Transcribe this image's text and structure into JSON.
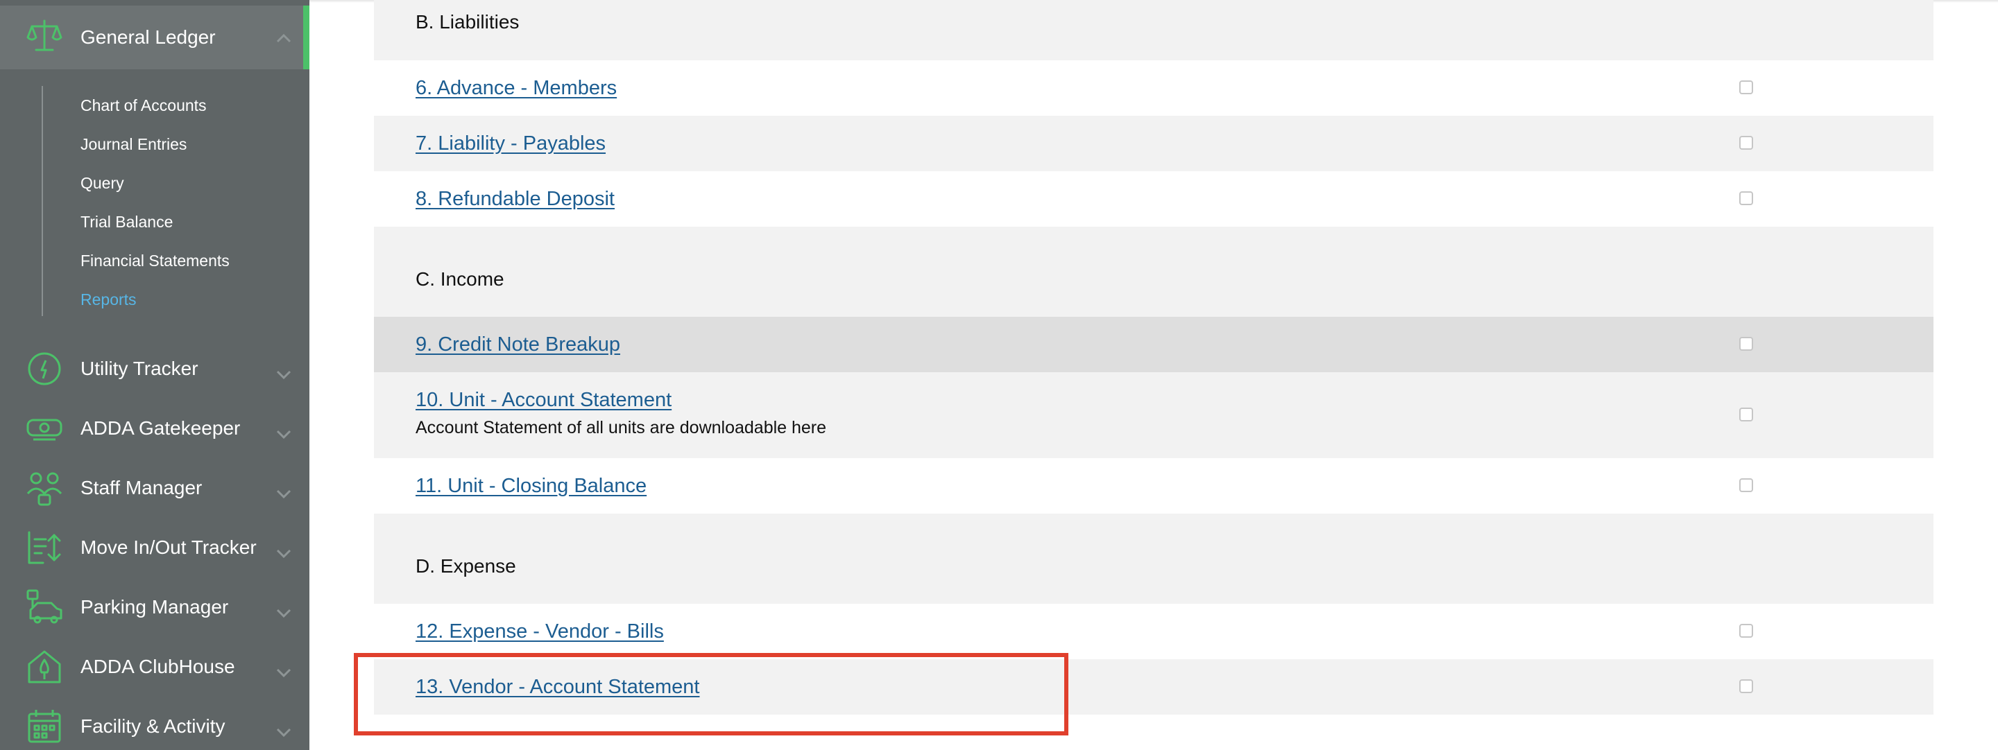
{
  "sidebar": {
    "general_ledger": {
      "label": "General Ledger",
      "sub_items": [
        {
          "label": "Chart of Accounts"
        },
        {
          "label": "Journal Entries"
        },
        {
          "label": "Query"
        },
        {
          "label": "Trial Balance"
        },
        {
          "label": "Financial Statements"
        },
        {
          "label": "Reports"
        }
      ]
    },
    "items": [
      {
        "label": "Utility Tracker",
        "icon": "gauge-icon"
      },
      {
        "label": "ADDA Gatekeeper",
        "icon": "gate-icon"
      },
      {
        "label": "Staff Manager",
        "icon": "staff-icon"
      },
      {
        "label": "Move In/Out Tracker",
        "icon": "move-icon"
      },
      {
        "label": "Parking Manager",
        "icon": "car-icon"
      },
      {
        "label": "ADDA ClubHouse",
        "icon": "clubhouse-icon"
      },
      {
        "label": "Facility & Activity",
        "icon": "calendar-icon"
      }
    ],
    "colors": {
      "accent": "#4cc169",
      "active_link": "#57b6e6",
      "background": "#5f6566"
    }
  },
  "reports": {
    "section_b": "B. Liabilities",
    "section_c": "C. Income",
    "section_d": "D. Expense",
    "rows": [
      {
        "label": "6. Advance - Members"
      },
      {
        "label": "7. Liability - Payables"
      },
      {
        "label": "8. Refundable Deposit"
      },
      {
        "label": "9. Credit Note Breakup"
      },
      {
        "label": "10. Unit - Account Statement",
        "description": "Account Statement of all units are downloadable here"
      },
      {
        "label": "11. Unit - Closing Balance"
      },
      {
        "label": "12. Expense - Vendor - Bills"
      },
      {
        "label": "13. Vendor - Account Statement"
      }
    ],
    "colors": {
      "link": "#1c5d91",
      "highlight_box": "#e0402d"
    }
  }
}
